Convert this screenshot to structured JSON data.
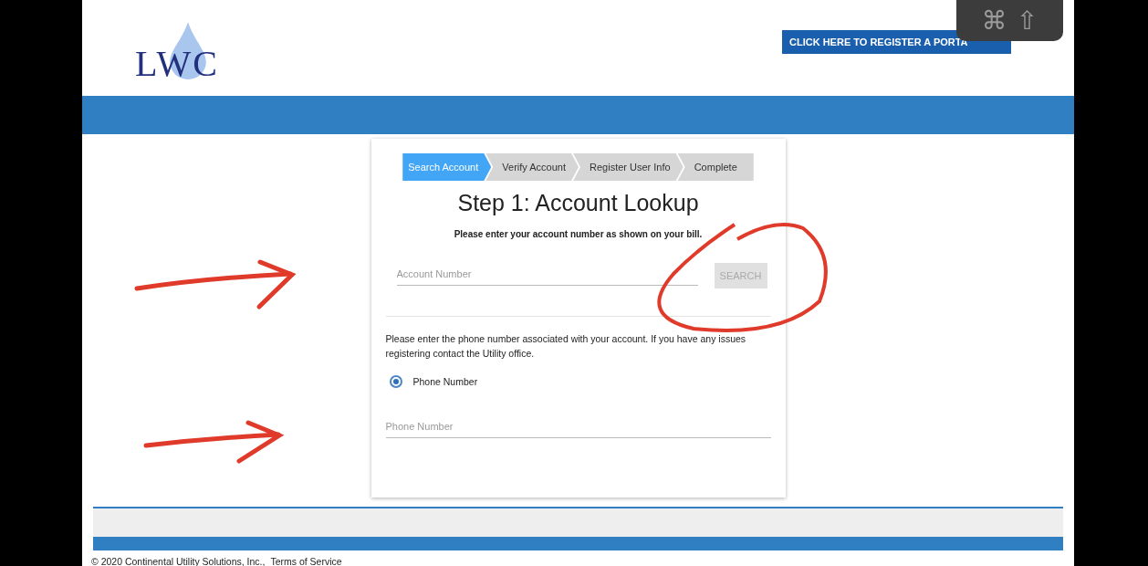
{
  "logo": {
    "text": "LWC"
  },
  "register_button": {
    "label": "CLICK HERE TO REGISTER A PORTA"
  },
  "keyboard_overlay": {
    "keys": [
      "⌘",
      "⇧"
    ]
  },
  "steps": [
    {
      "label": "Search Account",
      "selected": true
    },
    {
      "label": "Verify Account",
      "selected": false
    },
    {
      "label": "Register User Info",
      "selected": false
    },
    {
      "label": "Complete",
      "selected": false
    }
  ],
  "heading": "Step 1: Account Lookup",
  "instruction": "Please enter your account number as shown on your bill.",
  "account_field": {
    "placeholder": "Account Number"
  },
  "search_button": {
    "label": "SEARCH",
    "disabled": true
  },
  "phone_instruction": "Please enter the phone number associated with your account. If you have any issues registering contact the Utility office.",
  "radio_options": [
    {
      "label": "Phone Number",
      "selected": true
    }
  ],
  "phone_field": {
    "placeholder": "Phone Number"
  },
  "footer": {
    "copyright": "© 2020 Continental Utility Solutions, Inc.,",
    "terms_link": "Terms of Service"
  }
}
